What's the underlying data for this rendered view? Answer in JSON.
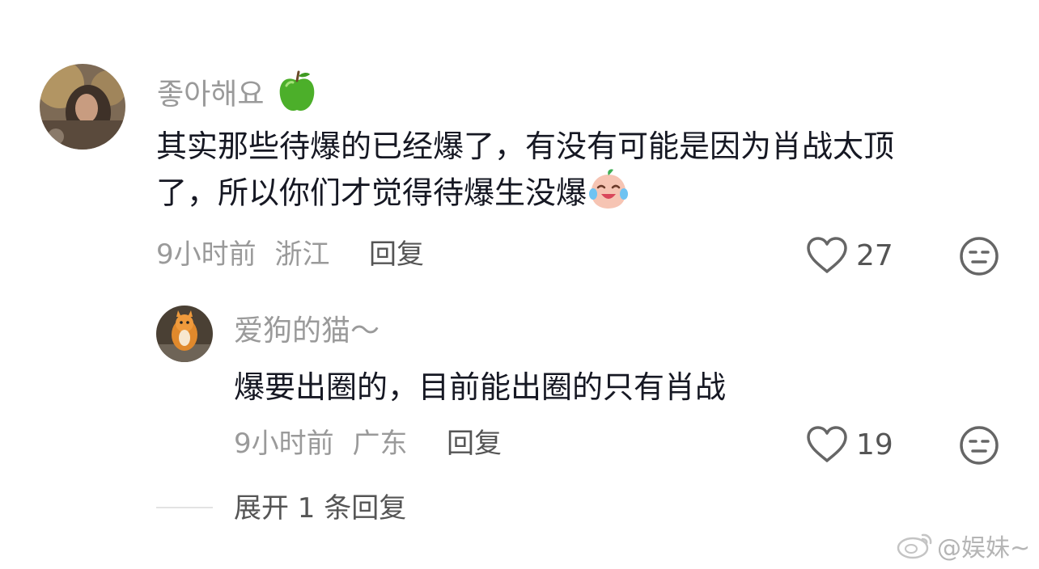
{
  "comments": [
    {
      "username": "좋아해요",
      "username_emoji_icon": "green-apple-icon",
      "text_line1": "其实那些待爆的已经爆了，有没有可能是因为肖战太顶",
      "text_line2": "了，所以你们才觉得待爆生没爆",
      "text_emoji_icon": "crying-laughing-peach-icon",
      "time": "9小时前",
      "location": "浙江",
      "reply_label": "回复",
      "likes": "27"
    }
  ],
  "replies": [
    {
      "username": "爱狗的猫～",
      "text": "爆要出圈的，目前能出圈的只有肖战",
      "time": "9小时前",
      "location": "广东",
      "reply_label": "回复",
      "likes": "19"
    }
  ],
  "expand_label": "展开 1 条回复",
  "watermark": "@娱妹~",
  "watermark_icon": "weibo-icon",
  "colors": {
    "meta_gray": "#9a9a9a",
    "text_dark": "#161823",
    "action_gray": "#555555"
  }
}
